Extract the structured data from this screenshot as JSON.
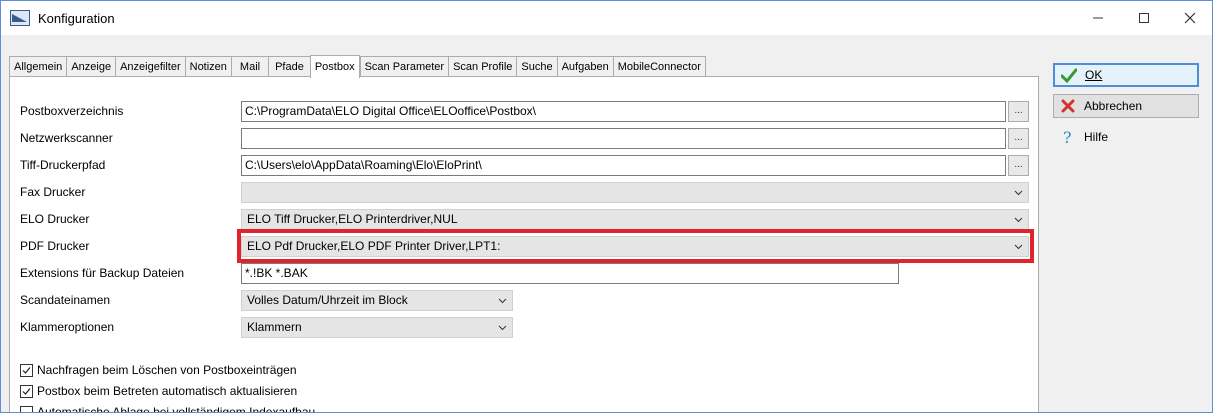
{
  "window": {
    "title": "Konfiguration"
  },
  "tabs": [
    {
      "label": "Allgemein",
      "active": false
    },
    {
      "label": "Anzeige",
      "active": false
    },
    {
      "label": "Anzeigefilter",
      "active": false
    },
    {
      "label": "Notizen",
      "active": false
    },
    {
      "label": "Mail",
      "active": false
    },
    {
      "label": "Pfade",
      "active": false
    },
    {
      "label": "Postbox",
      "active": true
    },
    {
      "label": "Scan Parameter",
      "active": false
    },
    {
      "label": "Scan Profile",
      "active": false
    },
    {
      "label": "Suche",
      "active": false
    },
    {
      "label": "Aufgaben",
      "active": false
    },
    {
      "label": "MobileConnector",
      "active": false
    }
  ],
  "form": {
    "postbox_dir": {
      "label": "Postboxverzeichnis",
      "value": "C:\\ProgramData\\ELO Digital Office\\ELOoffice\\Postbox\\"
    },
    "network_scanner": {
      "label": "Netzwerkscanner",
      "value": ""
    },
    "tiff_path": {
      "label": "Tiff-Druckerpfad",
      "value": "C:\\Users\\elo\\AppData\\Roaming\\Elo\\EloPrint\\"
    },
    "fax_printer": {
      "label": "Fax Drucker",
      "value": ""
    },
    "elo_printer": {
      "label": "ELO Drucker",
      "value": "ELO Tiff Drucker,ELO Printerdriver,NUL"
    },
    "pdf_printer": {
      "label": "PDF Drucker",
      "value": "ELO Pdf Drucker,ELO PDF Printer Driver,LPT1:"
    },
    "backup_ext": {
      "label": "Extensions für Backup Dateien",
      "value": "*.!BK *.BAK"
    },
    "scan_names": {
      "label": "Scandateinamen",
      "value": "Volles Datum/Uhrzeit im Block"
    },
    "clip_options": {
      "label": "Klammeroptionen",
      "value": "Klammern"
    },
    "browse_label": "..."
  },
  "checkboxes": [
    {
      "label": "Nachfragen beim Löschen von Postboxeinträgen",
      "checked": true
    },
    {
      "label": "Postbox beim Betreten automatisch aktualisieren",
      "checked": true
    },
    {
      "label": "Automatische Ablage bei vollständigem Indexaufbau",
      "checked": false
    }
  ],
  "buttons": {
    "ok": "OK",
    "cancel": "Abbrechen",
    "help": "Hilfe"
  },
  "colors": {
    "highlight": "#e1242c",
    "ok_border": "#4a8fd8"
  }
}
